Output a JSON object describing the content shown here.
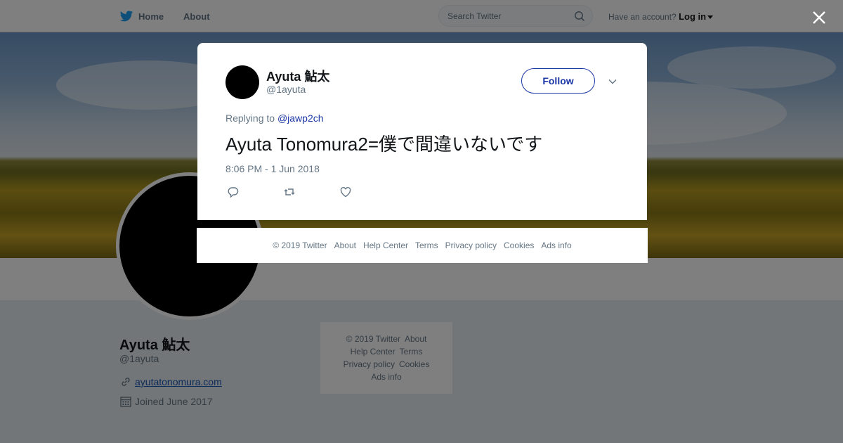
{
  "colors": {
    "accent": "#1b37a6",
    "link": "#1b57b5",
    "muted": "#657786",
    "text": "#14171a"
  },
  "topbar": {
    "home_label": "Home",
    "about_label": "About",
    "search_placeholder": "Search Twitter",
    "have_account": "Have an account?",
    "login_label": "Log in"
  },
  "profile": {
    "name": "Ayuta 鮎太",
    "handle": "@1ayuta",
    "website": "ayutatonomura.com",
    "joined": "Joined June 2017"
  },
  "side_footer": {
    "links": [
      "© 2019 Twitter",
      "About",
      "Help Center",
      "Terms",
      "Privacy policy",
      "Cookies",
      "Ads info"
    ]
  },
  "tweet": {
    "name": "Ayuta 鮎太",
    "handle": "@1ayuta",
    "follow_label": "Follow",
    "replying_prefix": "Replying to",
    "replying_to": "@jawp2ch",
    "text": "Ayuta Tonomura2=僕で間違いないです",
    "timestamp": "8:06 PM - 1 Jun 2018"
  },
  "footer": {
    "links": [
      "© 2019 Twitter",
      "About",
      "Help Center",
      "Terms",
      "Privacy policy",
      "Cookies",
      "Ads info"
    ]
  },
  "icons": [
    "twitter-bird-icon",
    "search-icon",
    "caret-down-icon",
    "close-icon",
    "chevron-down-icon",
    "reply-icon",
    "retweet-icon",
    "like-icon",
    "link-icon",
    "calendar-icon"
  ]
}
